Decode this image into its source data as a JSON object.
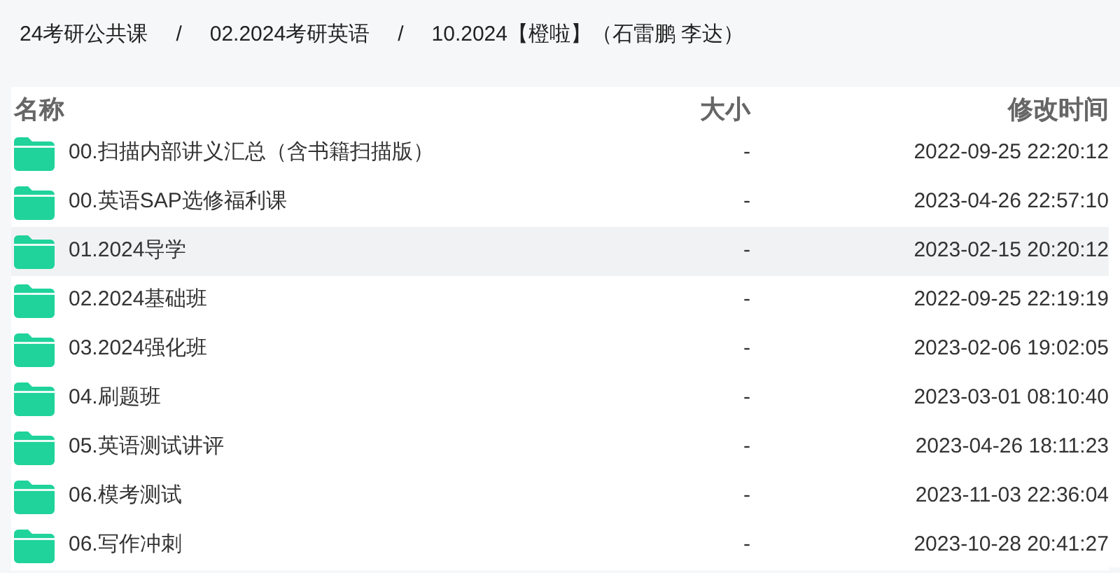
{
  "breadcrumb": [
    {
      "kind": "link",
      "text": "24考研公共课"
    },
    {
      "kind": "separator",
      "text": "/"
    },
    {
      "kind": "link",
      "text": "02.2024考研英语"
    },
    {
      "kind": "separator",
      "text": "/"
    },
    {
      "kind": "link",
      "text": "10.2024【橙啦】（石雷鹏 李达）"
    }
  ],
  "table": {
    "columns": [
      "名称",
      "大小",
      "修改时间"
    ],
    "rows": [
      {
        "name": "00.扫描内部讲义汇总（含书籍扫描版）",
        "size": "-",
        "modified": "2022-09-25 22:20:12",
        "selected": false
      },
      {
        "name": "00.英语SAP选修福利课",
        "size": "-",
        "modified": "2023-04-26 22:57:10",
        "selected": false
      },
      {
        "name": "01.2024导学",
        "size": "-",
        "modified": "2023-02-15 20:20:12",
        "selected": true
      },
      {
        "name": "02.2024基础班",
        "size": "-",
        "modified": "2022-09-25 22:19:19",
        "selected": false
      },
      {
        "name": "03.2024强化班",
        "size": "-",
        "modified": "2023-02-06 19:02:05",
        "selected": false
      },
      {
        "name": "04.刷题班",
        "size": "-",
        "modified": "2023-03-01 08:10:40",
        "selected": false
      },
      {
        "name": "05.英语测试讲评",
        "size": "-",
        "modified": "2023-04-26 18:11:23",
        "selected": false
      },
      {
        "name": "06.模考测试",
        "size": "-",
        "modified": "2023-11-03 22:36:04",
        "selected": false
      },
      {
        "name": "06.写作冲刺",
        "size": "-",
        "modified": "2023-10-28 20:41:27",
        "selected": false
      }
    ]
  }
}
